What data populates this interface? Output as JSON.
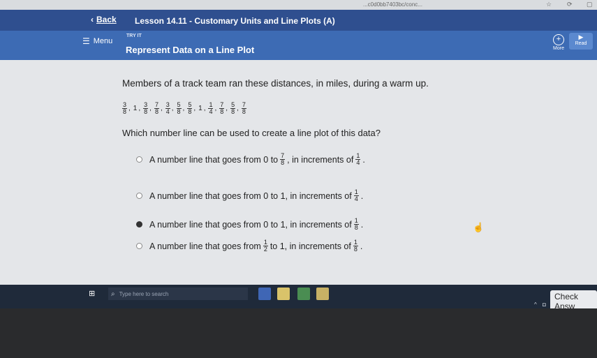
{
  "browser": {
    "url_fragment": "...c0d0bb7403bc/conc..."
  },
  "header": {
    "back_label": "Back",
    "lesson_title": "Lesson 14.11 - Customary Units and Line Plots (A)"
  },
  "subheader": {
    "menu_label": "Menu",
    "section_label": "TRY IT",
    "activity_title": "Represent Data on a Line Plot",
    "more_label": "More",
    "read_label": "Read"
  },
  "problem": {
    "prompt": "Members of a track team ran these distances, in miles, during a warm up.",
    "data_values": [
      {
        "num": "3",
        "den": "8"
      },
      {
        "whole": "1"
      },
      {
        "num": "3",
        "den": "8"
      },
      {
        "num": "7",
        "den": "8"
      },
      {
        "num": "3",
        "den": "4"
      },
      {
        "num": "5",
        "den": "8"
      },
      {
        "num": "5",
        "den": "8"
      },
      {
        "whole": "1"
      },
      {
        "num": "1",
        "den": "4"
      },
      {
        "num": "7",
        "den": "8"
      },
      {
        "num": "5",
        "den": "8"
      },
      {
        "num": "7",
        "den": "8"
      }
    ],
    "question": "Which number line can be used to create a line plot of this data?",
    "options": [
      {
        "pre": "A number line that goes from 0 to",
        "f1n": "7",
        "f1d": "8",
        "mid": ", in increments of",
        "f2n": "1",
        "f2d": "4",
        "post": ".",
        "selected": false
      },
      {
        "pre": "A number line that goes from 0 to 1, in increments of",
        "f2n": "1",
        "f2d": "4",
        "post": ".",
        "selected": false
      },
      {
        "pre": "A number line that goes from 0 to 1, in increments of",
        "f2n": "1",
        "f2d": "8",
        "post": ".",
        "selected": true
      },
      {
        "pre": "A number line that goes from",
        "f1n": "1",
        "f1d": "2",
        "mid": "to 1, in increments of",
        "f2n": "1",
        "f2d": "8",
        "post": ".",
        "selected": false
      }
    ]
  },
  "taskbar": {
    "search_placeholder": "Type here to search",
    "check_answer_label": "Check Answ"
  }
}
